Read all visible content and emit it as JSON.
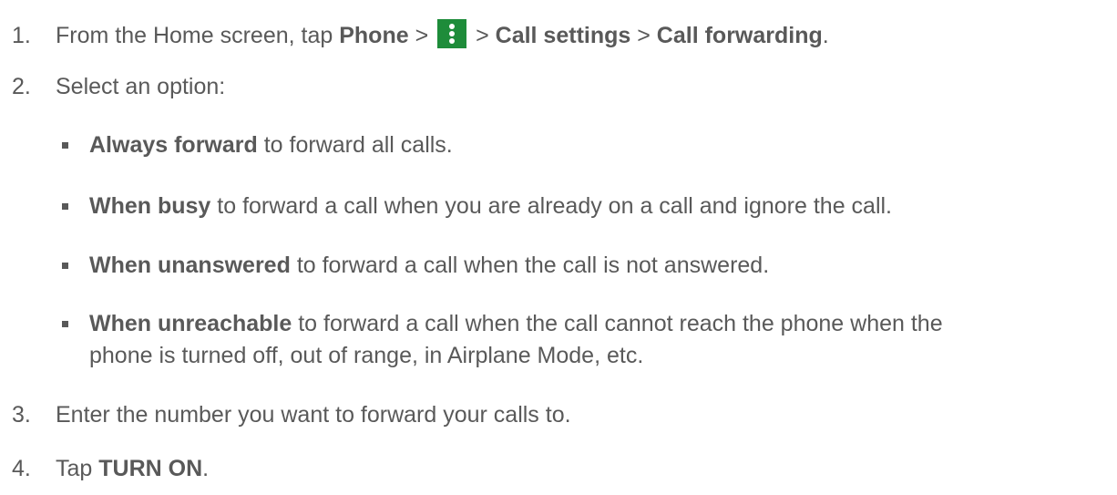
{
  "steps": [
    {
      "number": "1.",
      "prefix": "From the Home screen, tap ",
      "phone": "Phone",
      "sep1": " > ",
      "icon": "more-options-icon",
      "sep2": " > ",
      "call_settings": "Call settings",
      "sep3": " > ",
      "call_forwarding": "Call forwarding",
      "end": "."
    },
    {
      "number": "2.",
      "text": "Select an option:"
    },
    {
      "number": "3.",
      "text": "Enter the number you want to forward your calls to."
    },
    {
      "number": "4.",
      "prefix": "Tap ",
      "bold": "TURN ON",
      "end": "."
    }
  ],
  "options": [
    {
      "bold": "Always forward",
      "text": " to forward all calls."
    },
    {
      "bold": "When busy",
      "text": " to forward a call when you are already on a call and ignore the call."
    },
    {
      "bold": "When unanswered",
      "text": " to forward a call when the call is not answered."
    },
    {
      "bold": "When unreachable",
      "text": " to forward a call when the call cannot reach the phone when the",
      "text_line2": "phone is turned off, out of range, in Airplane Mode, etc."
    }
  ],
  "colors": {
    "text": "#595959",
    "icon_bg": "#1e8c3a",
    "icon_fg": "#ffffff"
  }
}
